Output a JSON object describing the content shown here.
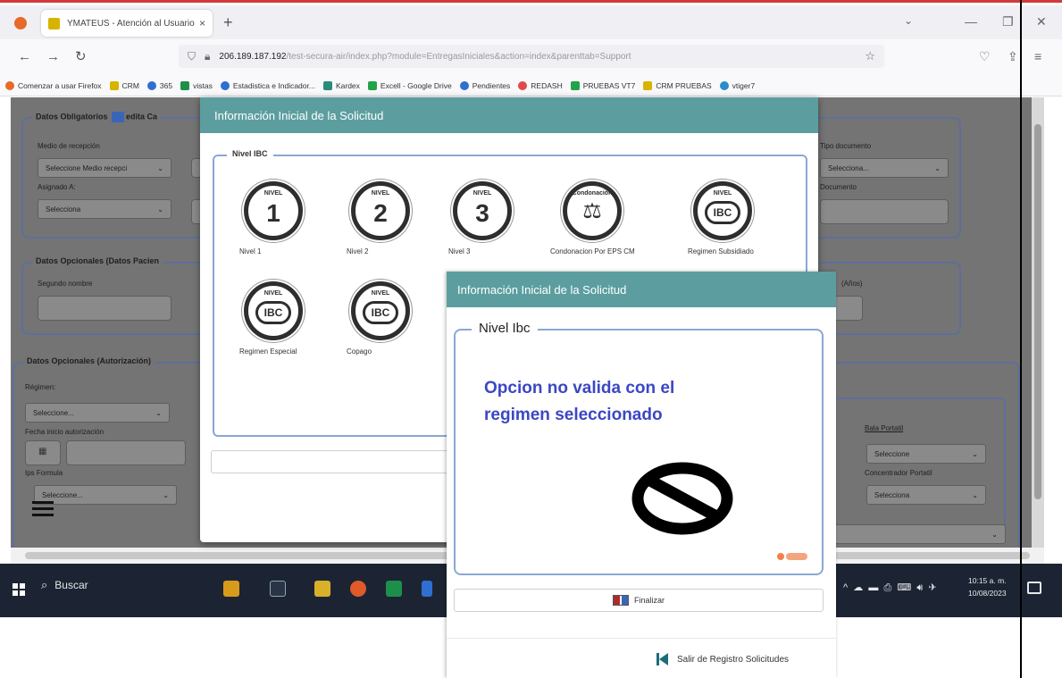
{
  "browser": {
    "tab_title": "YMATEUS - Atención al Usuario",
    "tab_close": "×",
    "new_tab": "+",
    "url_host": "206.189.187.192",
    "url_path": "/test-secura-air/index.php?module=EntregasIniciales&action=index&parenttab=Support",
    "bookmarks": [
      "Comenzar a usar Firefox",
      "CRM",
      "365",
      "vistas",
      "Estadistica e Indicador...",
      "Kardex",
      "Excell - Google Drive",
      "Pendientes",
      "REDASH",
      "PRUEBAS VT7",
      "CRM PRUEBAS",
      "vtiger7"
    ]
  },
  "background_form": {
    "datos_obligatorios": "Datos Obligatorios",
    "edita_label": "edita Ca",
    "medio_recepcion": "Medio de recepción",
    "medio_recepcion_value": "Seleccione Medio recepci",
    "asignado": "Asignado A:",
    "asignado_value": "Selecciona",
    "tipo_documento": "Tipo documento",
    "tipo_documento_value": "Selecciona...",
    "documento": "Documento",
    "datos_opcionales_paciente": "Datos Opcionales (Datos Pacien",
    "segundo_nombre": "Segundo nombre",
    "anios": "(Años)",
    "datos_opcionales_autorizacion": "Datos Opcionales (Autorización)",
    "regimen": "Régimen:",
    "regimen_value": "Seleccione...",
    "fecha_inicio": "Fecha inicio autorización",
    "ips_formula": "Ips Formula",
    "ips_formula_value": "Seleccione...",
    "bala_portatil": "Bala Portatil",
    "bala_portatil_value": "Seleccione",
    "concentrador_portatil": "Concentrador Portatil",
    "concentrador_value": "Selecciona"
  },
  "modal1": {
    "title": "Información Inicial de la Solicitud",
    "legend": "Nivel IBC",
    "badge_top": "NIVEL",
    "badge_condonacion_top": "Condonación",
    "ibc_text": "IBC",
    "options": [
      {
        "label": "Nivel 1",
        "number": "1"
      },
      {
        "label": "Nivel 2",
        "number": "2"
      },
      {
        "label": "Nivel 3",
        "number": "3"
      },
      {
        "label": "Condonacion Por EPS CM"
      },
      {
        "label": "Regimen Subsidiado"
      },
      {
        "label": "Regimen Especial"
      },
      {
        "label": "Copago"
      }
    ]
  },
  "modal2": {
    "title": "Información Inicial de la Solicitud",
    "legend": "Nivel Ibc",
    "message_line1": "Opcion no valida con el",
    "message_line2": "regimen seleccionado",
    "finalizar": "Finalizar",
    "salir": "Salir de Registro Solicitudes"
  },
  "taskbar": {
    "search": "Buscar",
    "time": "10:15 a. m.",
    "date": "10/08/2023"
  },
  "colors": {
    "modal_header": "#5c9ea0",
    "message_text": "#3b47c4",
    "fieldset_border": "#8aa7d4"
  }
}
